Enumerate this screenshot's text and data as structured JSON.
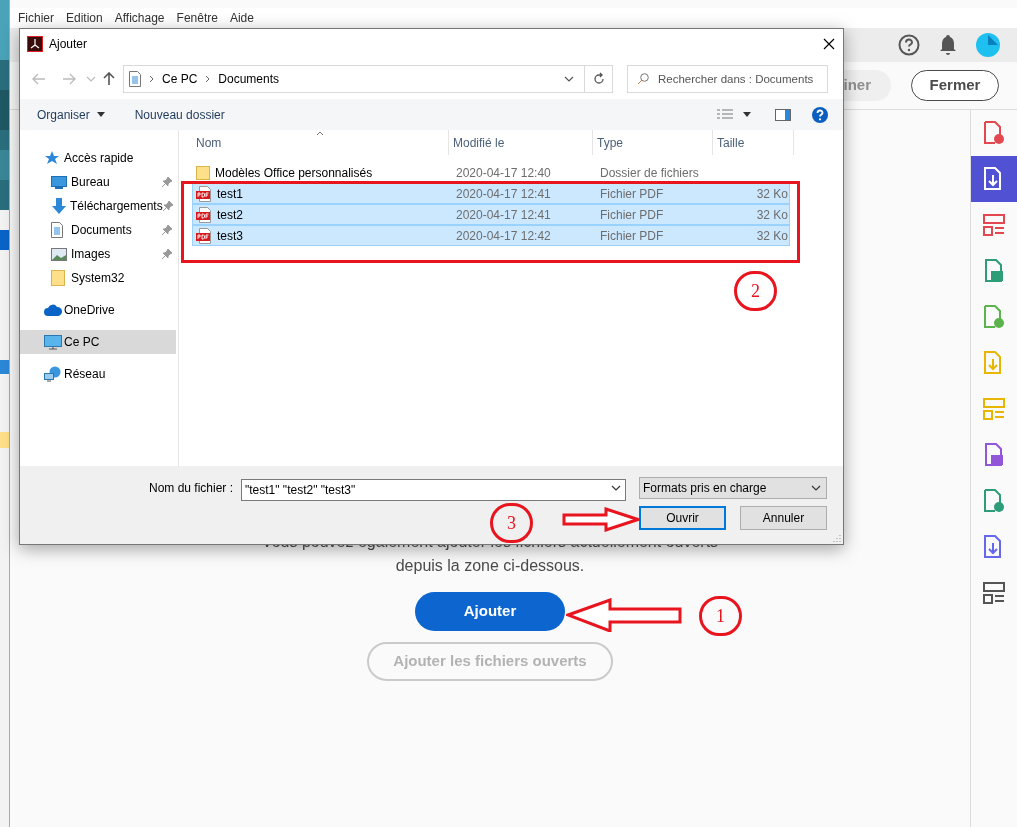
{
  "menu_bar": [
    "Fichier",
    "Edition",
    "Affichage",
    "Fenêtre",
    "Aide"
  ],
  "toolbar": {
    "partial_button": "iner",
    "close_button": "Fermer"
  },
  "tools": [
    {
      "selected": false
    },
    {
      "selected": true
    },
    {
      "selected": false
    },
    {
      "selected": false
    },
    {
      "selected": false
    },
    {
      "selected": false
    },
    {
      "selected": false
    },
    {
      "selected": false
    },
    {
      "selected": false
    },
    {
      "selected": false
    },
    {
      "selected": false
    }
  ],
  "message": "Vous pouvez également ajouter les fichiers actuellement ouverts depuis la zone ci-dessous.",
  "buttons": [
    {
      "label": "Ajouter",
      "disabled": false
    },
    {
      "label": "Ajouter les fichiers ouverts",
      "disabled": true
    }
  ],
  "dialog": {
    "title": "Ajouter",
    "path": [
      "Ce PC",
      "Documents"
    ],
    "search": {
      "placeholder": "Rechercher dans : Documents"
    },
    "toolbar": [
      {
        "label": "Organiser",
        "dropdown": true
      },
      {
        "label": "Nouveau dossier",
        "dropdown": false
      }
    ],
    "nav": [
      {
        "label": "Accès rapide",
        "kind": "star",
        "selected": false,
        "children": [
          {
            "label": "Bureau",
            "kind": "desktop",
            "pinned": true,
            "selected": false
          },
          {
            "label": "Téléchargements",
            "kind": "download",
            "pinned": true,
            "selected": false
          },
          {
            "label": "Documents",
            "kind": "document",
            "pinned": true,
            "selected": false
          },
          {
            "label": "Images",
            "kind": "images",
            "pinned": true,
            "selected": false
          },
          {
            "label": "System32",
            "kind": "folder",
            "pinned": false,
            "selected": false
          }
        ]
      },
      {
        "label": "OneDrive",
        "kind": "cloud",
        "selected": false
      },
      {
        "label": "Ce PC",
        "kind": "pc",
        "selected": true
      },
      {
        "label": "Réseau",
        "kind": "network",
        "selected": false
      }
    ],
    "columns": [
      "Nom",
      "Modifié le",
      "Type",
      "Taille"
    ],
    "rows": [
      {
        "kind": "folder",
        "name": "Modèles Office personnalisés",
        "modified": "2020-04-17 12:40",
        "type": "Dossier de fichiers",
        "selected": false
      },
      {
        "kind": "pdf",
        "name": "test1",
        "modified": "2020-04-17 12:41",
        "type": "Fichier PDF",
        "size": "32 Ko",
        "selected": true
      },
      {
        "kind": "pdf",
        "name": "test2",
        "modified": "2020-04-17 12:41",
        "type": "Fichier PDF",
        "size": "32 Ko",
        "selected": true
      },
      {
        "kind": "pdf",
        "name": "test3",
        "modified": "2020-04-17 12:42",
        "type": "Fichier PDF",
        "size": "32 Ko",
        "selected": true
      }
    ],
    "file_name": {
      "label": "Nom du fichier :",
      "value": "\"test1\" \"test2\" \"test3\""
    },
    "filter": "Formats pris en charge",
    "buttons": [
      {
        "label": "Ouvrir",
        "default": true
      },
      {
        "label": "Annuler",
        "default": false
      }
    ]
  },
  "annotations": [
    {
      "label": "1"
    },
    {
      "label": "2"
    },
    {
      "label": "3"
    }
  ]
}
